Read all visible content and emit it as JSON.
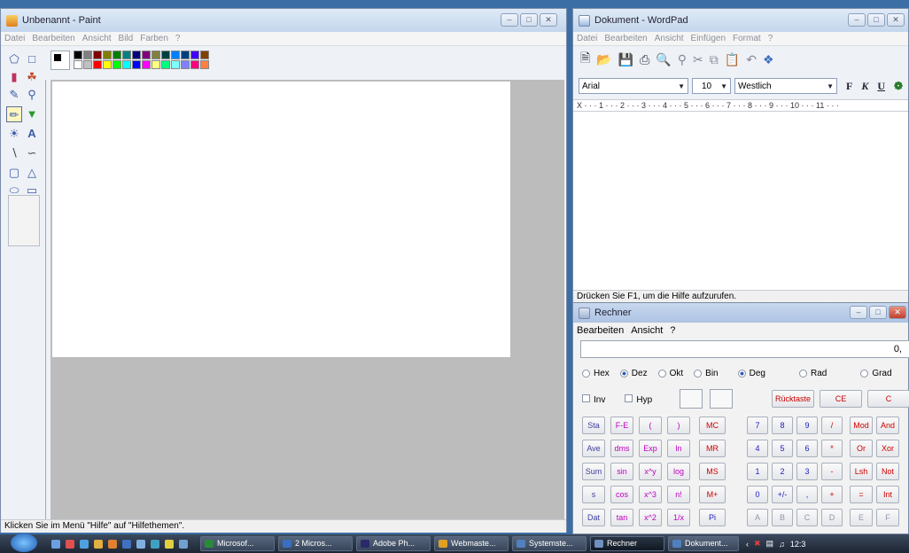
{
  "paint": {
    "title": "Unbenannt - Paint",
    "menu": [
      "Datei",
      "Bearbeiten",
      "Ansicht",
      "Bild",
      "Farben",
      "?"
    ],
    "tools": [
      "free-select-icon",
      "rect-select-icon",
      "eraser-icon",
      "fill-icon",
      "color-picker-icon",
      "magnifier-icon",
      "pencil-icon",
      "brush-icon",
      "airbrush-icon",
      "text-icon",
      "line-icon",
      "curve-icon",
      "rectangle-icon",
      "polygon-icon",
      "ellipse-icon",
      "rounded-rect-icon"
    ],
    "palette": [
      "#000000",
      "#808080",
      "#800000",
      "#808000",
      "#008000",
      "#008080",
      "#000080",
      "#800080",
      "#808040",
      "#004040",
      "#0080ff",
      "#004080",
      "#4000ff",
      "#804000",
      "#ffffff",
      "#c0c0c0",
      "#ff0000",
      "#ffff00",
      "#00ff00",
      "#00ffff",
      "#0000ff",
      "#ff00ff",
      "#ffff80",
      "#00ff80",
      "#80ffff",
      "#8080ff",
      "#ff0080",
      "#ff8040"
    ],
    "status": "Klicken Sie im Menü \"Hilfe\" auf \"Hilfethemen\"."
  },
  "wordpad": {
    "title": "Dokument - WordPad",
    "menu": [
      "Datei",
      "Bearbeiten",
      "Ansicht",
      "Einfügen",
      "Format",
      "?"
    ],
    "font": "Arial",
    "size": "10",
    "script": "Westlich",
    "format_buttons": [
      "F",
      "K",
      "U"
    ],
    "ruler": "X · · · 1 · · · 2 · · · 3 · · · 4 · · · 5 · · · 6 · · · 7 · · · 8 · · · 9 · · · 10 · · · 11 · · ·",
    "status": "Drücken Sie F1, um die Hilfe aufzurufen."
  },
  "calc": {
    "title": "Rechner",
    "menu": [
      "Bearbeiten",
      "Ansicht",
      "?"
    ],
    "display": "0,",
    "bases": [
      "Hex",
      "Dez",
      "Okt",
      "Bin"
    ],
    "angles": [
      "Deg",
      "Rad",
      "Grad"
    ],
    "checks": [
      "Inv",
      "Hyp"
    ],
    "top_buttons": [
      "Rücktaste",
      "CE",
      "C"
    ],
    "rows": [
      [
        "Sta",
        "F-E",
        "(",
        ")",
        "MC",
        "7",
        "8",
        "9",
        "/",
        "Mod",
        "And"
      ],
      [
        "Ave",
        "dms",
        "Exp",
        "ln",
        "MR",
        "4",
        "5",
        "6",
        "*",
        "Or",
        "Xor"
      ],
      [
        "Sum",
        "sin",
        "x^y",
        "log",
        "MS",
        "1",
        "2",
        "3",
        "-",
        "Lsh",
        "Not"
      ],
      [
        "s",
        "cos",
        "x^3",
        "n!",
        "M+",
        "0",
        "+/-",
        ",",
        "+",
        "=",
        "Int"
      ],
      [
        "Dat",
        "tan",
        "x^2",
        "1/x",
        "Pi",
        "A",
        "B",
        "C",
        "D",
        "E",
        "F"
      ]
    ]
  },
  "taskbar": {
    "tasks": [
      "Microsof...",
      "2 Micros...",
      "Adobe Ph...",
      "Webmaste...",
      "Systemste...",
      "Rechner",
      "Dokument..."
    ],
    "active": "Rechner",
    "clock": "12:3"
  },
  "colors": {
    "accent": "#2a5bbf",
    "calc_blue": "#2020c0",
    "calc_red": "#d00000",
    "calc_magenta": "#c000c0"
  }
}
